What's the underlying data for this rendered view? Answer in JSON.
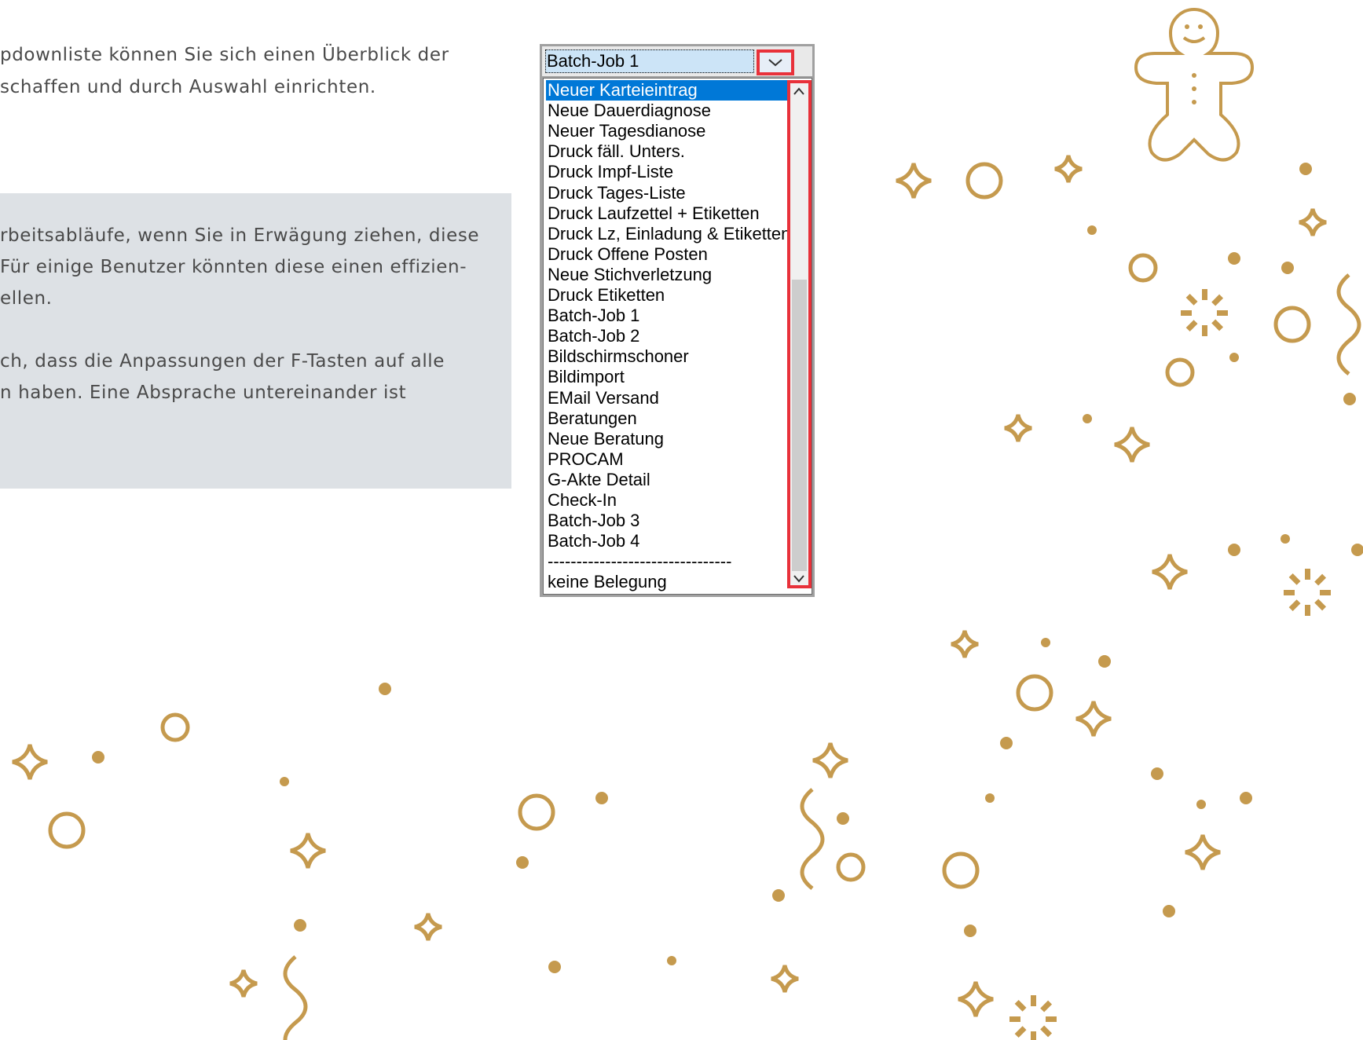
{
  "intro": {
    "line1": "pdownliste können Sie sich einen Überblick der",
    "line2": "schaffen und durch Auswahl einrichten."
  },
  "note": {
    "line1": "rbeitsabläufe, wenn Sie in Erwägung ziehen, diese",
    "line2": " Für einige Benutzer könnten diese einen effizien-",
    "line3": "ellen.",
    "line4": "ch, dass die Anpassungen der F-Tasten auf alle",
    "line5": "n haben. Eine Absprache untereinander ist"
  },
  "combobox": {
    "selected_value": "Batch-Job 1",
    "items": [
      "Neuer Karteieintrag",
      "Neue Dauerdiagnose",
      "Neuer Tagesdianose",
      "Druck fäll. Unters.",
      "Druck Impf-Liste",
      "Druck Tages-Liste",
      "Druck Laufzettel + Etiketten",
      "Druck Lz, Einladung & Etiketten",
      "Druck Offene Posten",
      "Neue Stichverletzung",
      "Druck Etiketten",
      "Batch-Job 1",
      "Batch-Job 2",
      "Bildschirmschoner",
      "Bildimport",
      "EMail Versand",
      "Beratungen",
      "Neue Beratung",
      "PROCAM",
      "G-Akte Detail",
      "Check-In",
      "Batch-Job 3",
      "Batch-Job 4",
      "--------------------------------",
      "keine Belegung"
    ],
    "highlighted_item": "Neuer Karteieintrag"
  },
  "colors": {
    "highlight": "#e8313a",
    "selection": "#0078d7",
    "decoration": "#c59a4e",
    "note_background": "#dde1e5"
  },
  "icons": {
    "dropdown": "chevron-down-icon",
    "scroll_up": "arrow-up-icon",
    "scroll_down": "arrow-down-icon"
  }
}
